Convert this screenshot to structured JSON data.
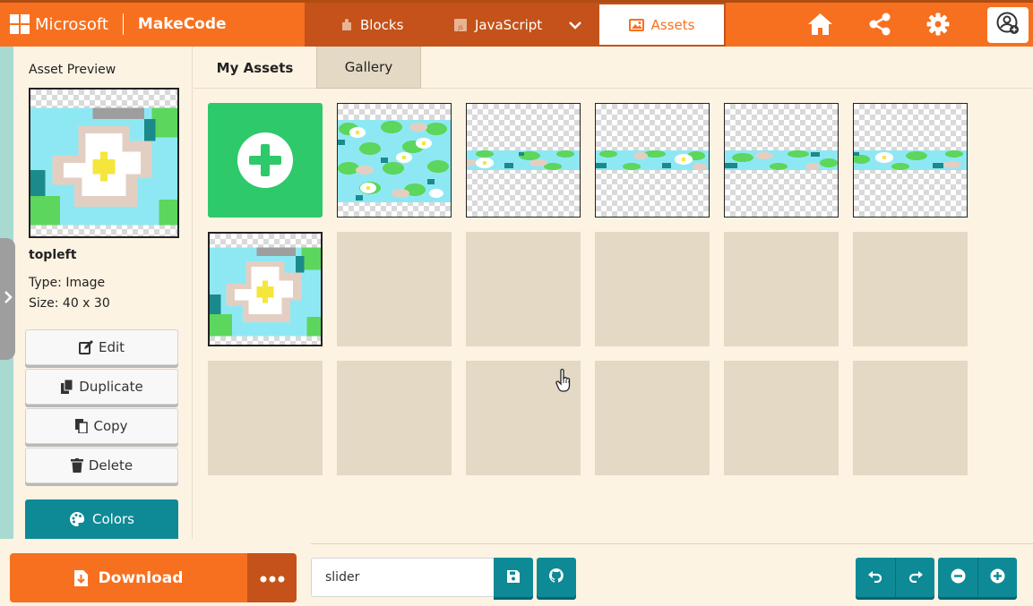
{
  "header": {
    "brand_microsoft": "Microsoft",
    "brand_makecode": "MakeCode",
    "tabs": [
      {
        "label": "Blocks",
        "icon": "puzzle-icon"
      },
      {
        "label": "JavaScript",
        "icon": "js-file-icon"
      },
      {
        "label": "Assets",
        "icon": "image-icon",
        "active": true
      }
    ],
    "icons": [
      "home-icon",
      "share-icon",
      "gear-icon",
      "user-icon"
    ],
    "colors": {
      "orange": "#f7701f",
      "dark_orange": "#c4521a"
    }
  },
  "preview": {
    "title": "Asset Preview",
    "name": "topleft",
    "type_label": "Type: Image",
    "size_label": "Size: 40 x 30"
  },
  "actions": {
    "edit": "Edit",
    "duplicate": "Duplicate",
    "copy": "Copy",
    "delete": "Delete",
    "colors": "Colors"
  },
  "asset_tabs": {
    "my_assets": "My Assets",
    "gallery": "Gallery"
  },
  "bottom": {
    "download": "Download",
    "project_name": "slider",
    "teal": "#0e8a96"
  }
}
